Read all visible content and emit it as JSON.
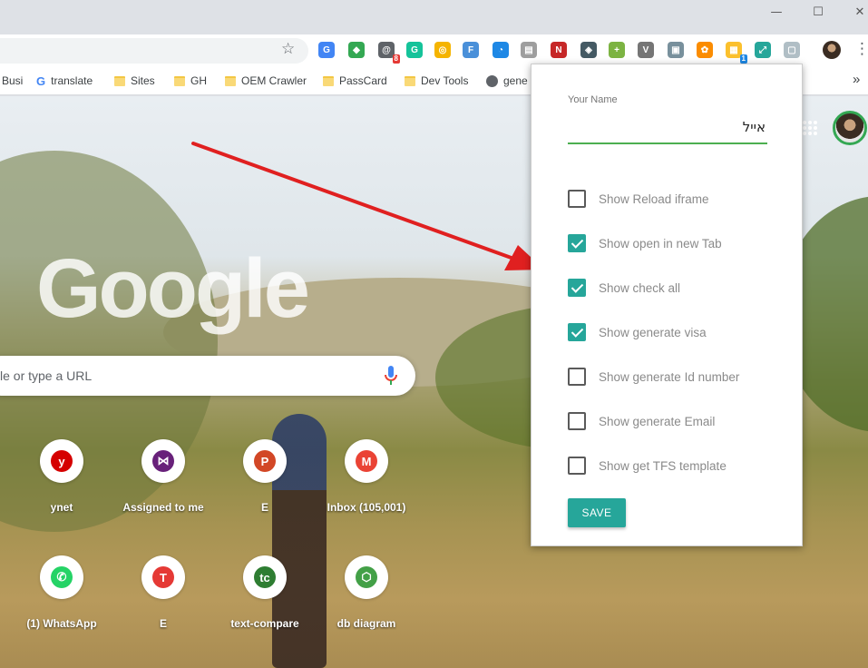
{
  "window": {
    "minimize_glyph": "—",
    "maximize_glyph": "☐",
    "close_glyph": "✕"
  },
  "toolbar": {
    "bookmark_star_glyph": "☆",
    "extensions": [
      {
        "name": "google-translate-icon",
        "glyph": "G",
        "color": "#4285f4"
      },
      {
        "name": "maps-extension-icon",
        "glyph": "◆",
        "color": "#34a853"
      },
      {
        "name": "mail-checker-icon",
        "glyph": "@",
        "color": "#5f6368",
        "badge": "8",
        "badge_color": "#e53935"
      },
      {
        "name": "grammarly-icon",
        "glyph": "G",
        "color": "#15c39a"
      },
      {
        "name": "norton-icon",
        "glyph": "◎",
        "color": "#f5b400"
      },
      {
        "name": "ft-extension-icon",
        "glyph": "F",
        "color": "#4a90d9"
      },
      {
        "name": "speedtest-icon",
        "glyph": "◔",
        "color": "#1e88e5"
      },
      {
        "name": "tab-manager-icon",
        "glyph": "▤",
        "color": "#9e9e9e"
      },
      {
        "name": "n-extension-icon",
        "glyph": "N",
        "color": "#c62828"
      },
      {
        "name": "shield-extension-icon",
        "glyph": "◈",
        "color": "#455a64"
      },
      {
        "name": "plus-extension-icon",
        "glyph": "+",
        "color": "#7cb342"
      },
      {
        "name": "v-extension-icon",
        "glyph": "V",
        "color": "#757575"
      },
      {
        "name": "image-extension-icon",
        "glyph": "▣",
        "color": "#78909c"
      },
      {
        "name": "colorpicker-icon",
        "glyph": "✿",
        "color": "#fb8c00"
      },
      {
        "name": "news-extension-icon",
        "glyph": "▦",
        "color": "#fbc02d",
        "badge": "1",
        "badge_color": "#1e88e5"
      },
      {
        "name": "expand-extension-icon",
        "glyph": "⤢",
        "color": "#26a69a"
      },
      {
        "name": "helper-extension-icon",
        "glyph": "▢",
        "color": "#b0bec5"
      }
    ],
    "menu_glyph": "⋮"
  },
  "bookmarks": {
    "items": [
      {
        "label": "Busi",
        "icon": "none"
      },
      {
        "label": "translate",
        "icon": "google"
      },
      {
        "label": "Sites",
        "icon": "folder"
      },
      {
        "label": "GH",
        "icon": "folder"
      },
      {
        "label": "OEM Crawler",
        "icon": "folder"
      },
      {
        "label": "PassCard",
        "icon": "folder"
      },
      {
        "label": "Dev Tools",
        "icon": "folder"
      },
      {
        "label": "gene",
        "icon": "globe"
      }
    ],
    "overflow_glyph": "»"
  },
  "newtab": {
    "logo": "Google",
    "search_placeholder": "le or type a URL",
    "shortcuts": [
      {
        "label": "ynet",
        "glyph": "y",
        "color": "#d50000"
      },
      {
        "label": "Assigned to me",
        "glyph": "⋈",
        "color": "#68217a"
      },
      {
        "label": "E",
        "glyph": "P",
        "color": "#d24726"
      },
      {
        "label": "Inbox (105,001)",
        "glyph": "M",
        "color": "#ea4335"
      },
      {
        "label": "(1) WhatsApp",
        "glyph": "✆",
        "color": "#25d366"
      },
      {
        "label": "E",
        "glyph": "T",
        "color": "#e53935"
      },
      {
        "label": "text-compare",
        "glyph": "tc",
        "color": "#2e7d32"
      },
      {
        "label": "db diagram",
        "glyph": "⬡",
        "color": "#43a047"
      }
    ]
  },
  "popup": {
    "name_label": "Your Name",
    "name_value": "אייל",
    "options": [
      {
        "label": "Show Reload iframe",
        "checked": false
      },
      {
        "label": "Show open in new Tab",
        "checked": true
      },
      {
        "label": "Show check all",
        "checked": true
      },
      {
        "label": "Show generate visa",
        "checked": true
      },
      {
        "label": "Show generate Id number",
        "checked": false
      },
      {
        "label": "Show generate Email",
        "checked": false
      },
      {
        "label": "Show get TFS template",
        "checked": false
      }
    ],
    "save_label": "SAVE",
    "accent_color": "#26a69a"
  },
  "annotation": {
    "arrow_color": "#e02020"
  }
}
